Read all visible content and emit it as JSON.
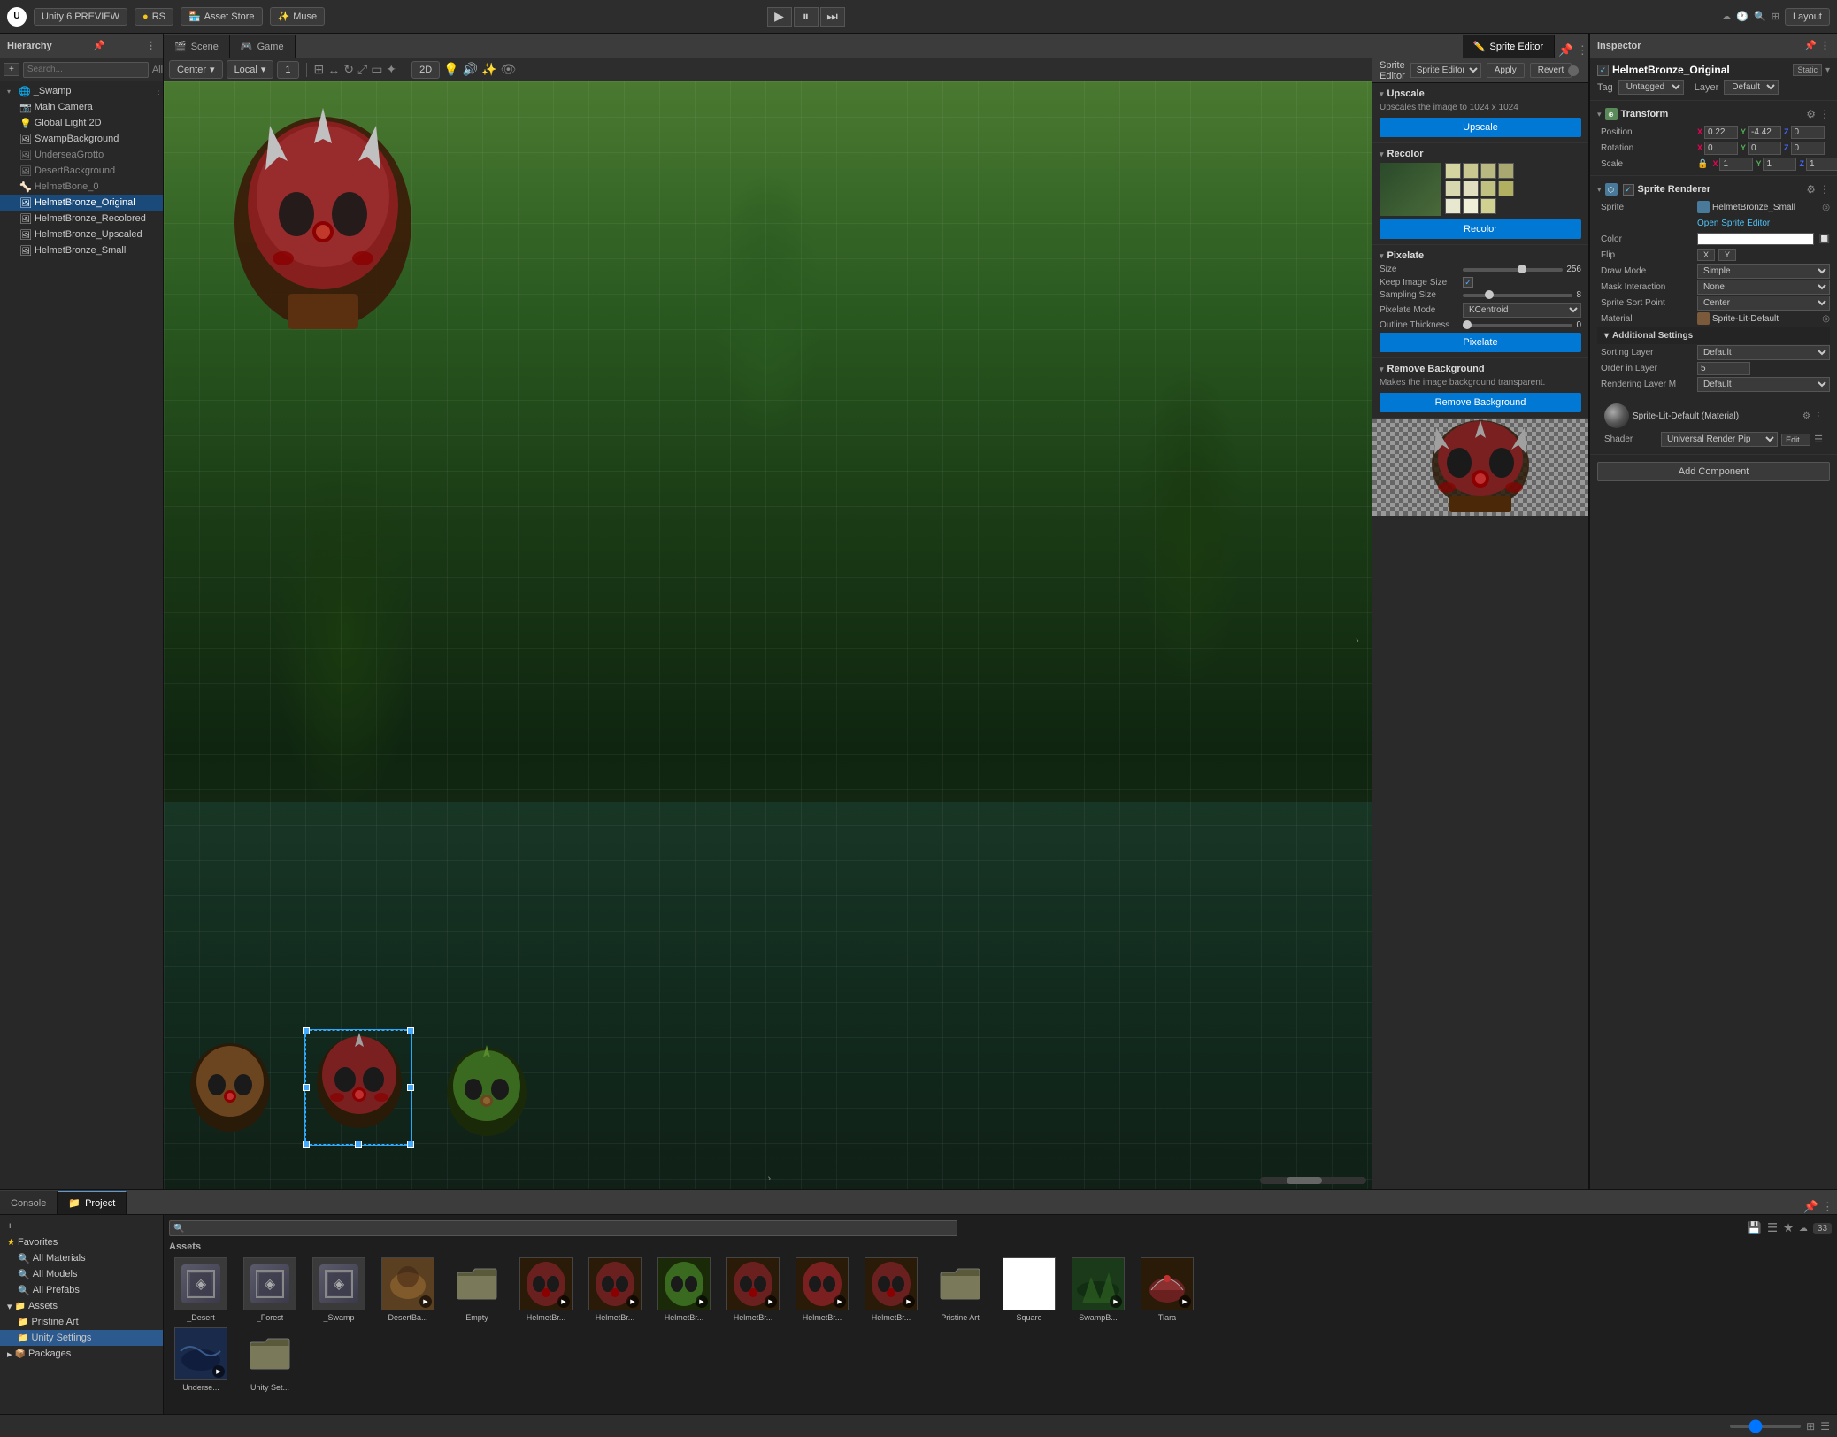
{
  "app": {
    "title": "Unity 6 PREVIEW",
    "version_badge": "PREVIEW"
  },
  "top_bar": {
    "unity_label": "Unity 6",
    "rs_label": "RS",
    "asset_store": "Asset Store",
    "muse": "Muse",
    "layout": "Layout",
    "play_icon": "▶",
    "pause_icon": "⏸",
    "step_icon": "⏭"
  },
  "hierarchy": {
    "title": "Hierarchy",
    "search_placeholder": "Search...",
    "items": [
      {
        "label": "▾ _Swamp",
        "indent": 0,
        "icon": "🌐"
      },
      {
        "label": "Main Camera",
        "indent": 1,
        "icon": "📷"
      },
      {
        "label": "Global Light 2D",
        "indent": 1,
        "icon": "💡"
      },
      {
        "label": "SwampBackground",
        "indent": 1,
        "icon": "🖼"
      },
      {
        "label": "UnderseaGrotto",
        "indent": 1,
        "icon": "🖼"
      },
      {
        "label": "DesertBackground",
        "indent": 1,
        "icon": "🖼"
      },
      {
        "label": "HelmetBone_0",
        "indent": 1,
        "icon": "🦴"
      },
      {
        "label": "HelmetBronze_Original",
        "indent": 1,
        "icon": "🖼",
        "selected": true
      },
      {
        "label": "HelmetBronze_Recolored",
        "indent": 1,
        "icon": "🖼"
      },
      {
        "label": "HelmetBronze_Upscaled",
        "indent": 1,
        "icon": "🖼"
      },
      {
        "label": "HelmetBronze_Small",
        "indent": 1,
        "icon": "🖼"
      }
    ]
  },
  "scene_tab": {
    "label": "Scene",
    "icon": "🎬"
  },
  "game_tab": {
    "label": "Game",
    "icon": "🎮"
  },
  "sprite_editor_tab": {
    "label": "Sprite Editor",
    "icon": "✏️"
  },
  "scene_toolbar": {
    "center": "Center",
    "local": "Local",
    "step": "1",
    "mode_2d": "2D"
  },
  "sprite_editor": {
    "title": "Sprite Editor",
    "apply_btn": "Apply",
    "revert_btn": "Revert",
    "sections": {
      "upscale": {
        "header": "Upscale",
        "description": "Upscales the image to 1024 x 1024",
        "btn_label": "Upscale"
      },
      "recolor": {
        "header": "Recolor",
        "btn_label": "Recolor"
      },
      "pixelate": {
        "header": "Pixelate",
        "size_label": "Size",
        "size_value": "256",
        "keep_image_size_label": "Keep Image Size",
        "keep_image_size_value": true,
        "sampling_size_label": "Sampling Size",
        "sampling_size_value": "8",
        "pixelate_mode_label": "Pixelate Mode",
        "pixelate_mode_value": "KCentroid",
        "outline_thickness_label": "Outline Thickness",
        "outline_thickness_value": "0",
        "btn_label": "Pixelate"
      },
      "remove_background": {
        "header": "Remove Background",
        "description": "Makes the image background transparent.",
        "btn_label": "Remove Background"
      }
    }
  },
  "inspector": {
    "title": "Inspector",
    "object_name": "HelmetBronze_Original",
    "tag": "Untagged",
    "layer": "Default",
    "static_label": "Static",
    "transform": {
      "header": "Transform",
      "position": {
        "x": "0.22",
        "y": "-4.42",
        "z": "0"
      },
      "rotation": {
        "x": "0",
        "y": "0",
        "z": "0"
      },
      "scale": {
        "x": "1",
        "y": "1",
        "z": "1"
      }
    },
    "sprite_renderer": {
      "header": "Sprite Renderer",
      "sprite": "HelmetBronze_Small",
      "open_sprite_editor": "Open Sprite Editor",
      "color_label": "Color",
      "flip_label": "Flip",
      "flip_x": "X",
      "flip_y": "Y",
      "draw_mode_label": "Draw Mode",
      "draw_mode_value": "Simple",
      "mask_interaction_label": "Mask Interaction",
      "mask_interaction_value": "None",
      "sprite_sort_point_label": "Sprite Sort Point",
      "sprite_sort_point_value": "Center",
      "material_label": "Material",
      "material_value": "Sprite-Lit-Default",
      "additional_settings": "Additional Settings",
      "sorting_layer_label": "Sorting Layer",
      "sorting_layer_value": "Default",
      "order_in_layer_label": "Order in Layer",
      "order_in_layer_value": "5",
      "rendering_layer_label": "Rendering Layer M",
      "rendering_layer_value": "Default"
    },
    "material_section": {
      "name": "Sprite-Lit-Default (Material)",
      "shader_label": "Shader",
      "shader_value": "Universal Render Pip",
      "edit_btn": "Edit..."
    },
    "add_component_btn": "Add Component"
  },
  "bottom": {
    "console_tab": "Console",
    "project_tab": "Project",
    "assets_header": "Assets",
    "asset_count": "33",
    "project_items": [
      {
        "label": "Favorites",
        "icon": "★",
        "type": "header"
      },
      {
        "label": "All Materials",
        "indent": 1
      },
      {
        "label": "All Models",
        "indent": 1
      },
      {
        "label": "All Prefabs",
        "indent": 1
      },
      {
        "label": "Assets",
        "icon": "📁",
        "type": "header"
      },
      {
        "label": "Pristine Art",
        "indent": 1,
        "icon": "📁"
      },
      {
        "label": "Unity Settings",
        "indent": 1,
        "icon": "📁"
      },
      {
        "label": "Packages",
        "icon": "📦",
        "type": "header"
      }
    ],
    "assets": [
      {
        "label": "_Desert",
        "type": "3d"
      },
      {
        "label": "_Forest",
        "type": "3d"
      },
      {
        "label": "_Swamp",
        "type": "3d"
      },
      {
        "label": "DesertBa...",
        "type": "helmet"
      },
      {
        "label": "Empty",
        "type": "folder"
      },
      {
        "label": "HelmetBr...",
        "type": "helmet"
      },
      {
        "label": "HelmetBr...",
        "type": "helmet"
      },
      {
        "label": "HelmetBr...",
        "type": "helmet"
      },
      {
        "label": "HelmetBr...",
        "type": "helmet"
      },
      {
        "label": "HelmetBr...",
        "type": "helmet"
      },
      {
        "label": "HelmetBr...",
        "type": "helmet"
      },
      {
        "label": "Pristine Art",
        "type": "folder"
      },
      {
        "label": "Square",
        "type": "white_square"
      },
      {
        "label": "SwampB...",
        "type": "swamp"
      },
      {
        "label": "Tiara",
        "type": "helmet2"
      },
      {
        "label": "Underse...",
        "type": "img2",
        "row2": true
      },
      {
        "label": "Unity Set...",
        "type": "folder2",
        "row2": true
      }
    ]
  },
  "status_bar": {
    "unity_settings": "Unity Settings"
  },
  "colors": {
    "accent_blue": "#0078d4",
    "selected_blue": "#2d5a8e",
    "header_bg": "#3c3c3c",
    "panel_bg": "#282828",
    "dark_bg": "#1e1e1e"
  }
}
